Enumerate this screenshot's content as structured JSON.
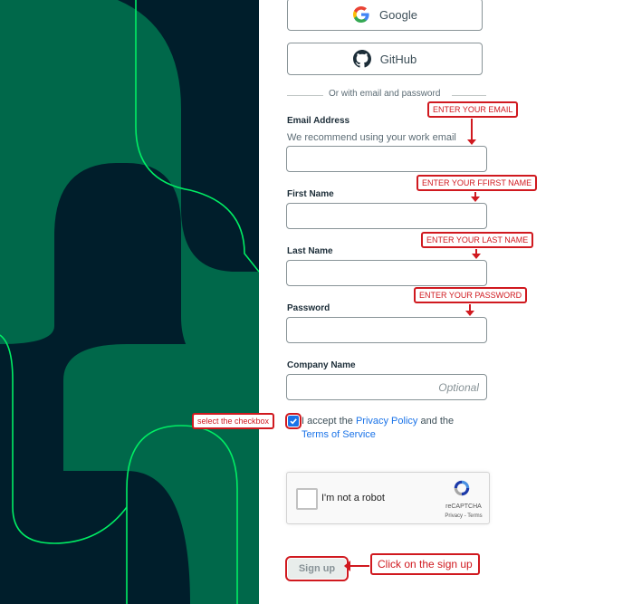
{
  "oauth": {
    "google_label": "Google",
    "github_label": "GitHub"
  },
  "divider_text": "Or with email and password",
  "fields": {
    "email": {
      "label": "Email Address",
      "hint": "We recommend using your work email",
      "value": ""
    },
    "first_name": {
      "label": "First Name",
      "value": ""
    },
    "last_name": {
      "label": "Last Name",
      "value": ""
    },
    "password": {
      "label": "Password",
      "value": ""
    },
    "company": {
      "label": "Company Name",
      "placeholder": "Optional",
      "value": ""
    }
  },
  "terms": {
    "prefix": "I accept the ",
    "privacy_link": "Privacy Policy",
    "middle": " and the ",
    "tos_link": "Terms of Service",
    "checked": true
  },
  "captcha": {
    "label": "I'm not a robot",
    "brand": "reCAPTCHA",
    "links": "Privacy - Terms"
  },
  "signup_label": "Sign up",
  "annotations": {
    "email": "ENTER YOUR EMAIL",
    "first_name": "ENTER YOUR FFIRST NAME",
    "last_name": "ENTER YOUR LAST NAME",
    "password": "ENTER YOUR PASSWORD",
    "checkbox": "select the checkbox",
    "signup": "Click on the sign up"
  },
  "colors": {
    "panel_dark": "#001e2b",
    "panel_green": "#00684a",
    "accent_line": "#00ed64",
    "annotation_red": "#d0191f",
    "link_blue": "#1a73e8"
  }
}
